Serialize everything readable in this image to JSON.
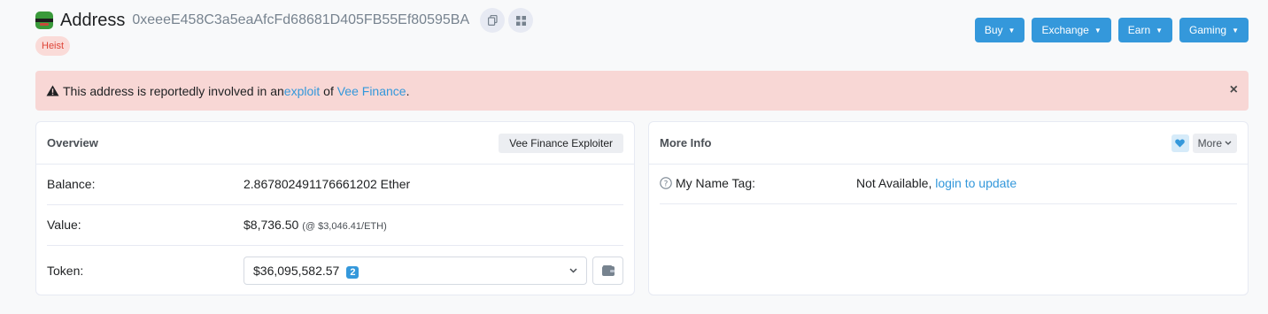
{
  "header": {
    "title": "Address",
    "address": "0xeeeE458C3a5eaAfcFd68681D405FB55Ef80595BA",
    "tag": "Heist"
  },
  "nav": [
    {
      "label": "Buy"
    },
    {
      "label": "Exchange"
    },
    {
      "label": "Earn"
    },
    {
      "label": "Gaming"
    }
  ],
  "alert": {
    "text_before": "This address is reportedly involved in an ",
    "link1": "exploit",
    "text_middle": " of ",
    "link2": "Vee Finance",
    "text_after": ".",
    "close": "×"
  },
  "overview": {
    "title": "Overview",
    "label_button": "Vee Finance Exploiter",
    "balance_label": "Balance:",
    "balance_value": "2.867802491176661202 Ether",
    "value_label": "Value:",
    "value_amount": "$8,736.50",
    "value_rate": "(@ $3,046.41/ETH)",
    "token_label": "Token:",
    "token_value": "$36,095,582.57",
    "token_count": "2"
  },
  "more_info": {
    "title": "More Info",
    "more_label": "More",
    "name_tag_label": "My Name Tag:",
    "name_tag_value": "Not Available, ",
    "name_tag_link": "login to update"
  },
  "colors": {
    "accent": "#3498db",
    "alert_bg": "#f8d7d5",
    "danger": "#de4437"
  }
}
